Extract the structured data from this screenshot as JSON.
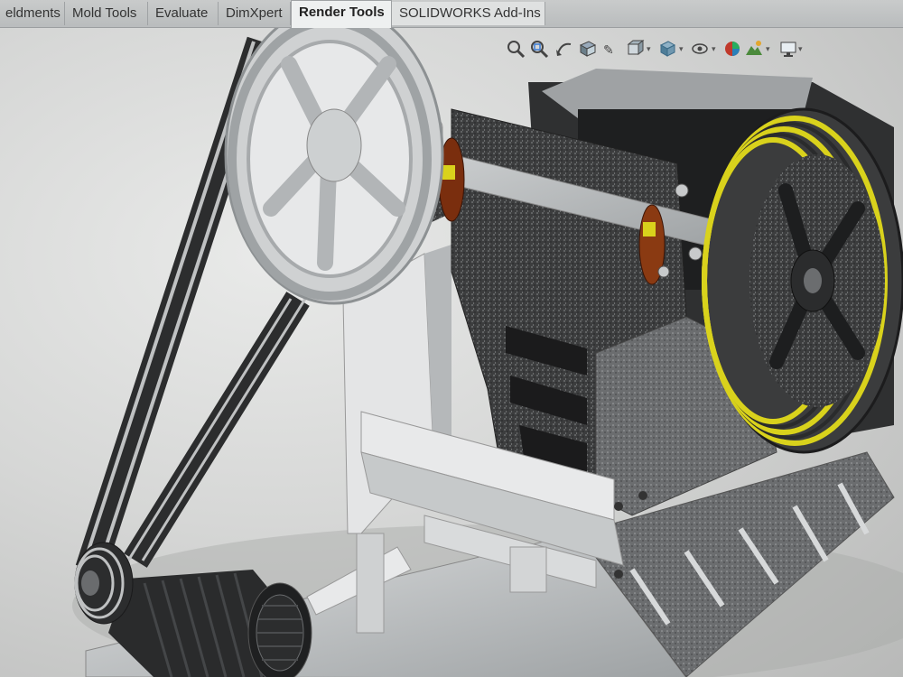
{
  "tabs": [
    {
      "label": "Weldments",
      "visible_label": "eldments"
    },
    {
      "label": "Mold Tools"
    },
    {
      "label": "Evaluate"
    },
    {
      "label": "DimXpert"
    },
    {
      "label": "Render Tools"
    },
    {
      "label": "SOLIDWORKS Add-Ins"
    }
  ],
  "active_tab": "Render Tools",
  "heads_up_toolbar": {
    "icons": [
      "zoom-to-fit-icon",
      "zoom-to-area-icon",
      "previous-view-icon",
      "section-view-icon",
      "dynamic-annotation-icon",
      "view-orientation-icon",
      "display-style-icon",
      "hide-show-items-icon",
      "edit-appearance-icon",
      "apply-scene-icon",
      "view-settings-icon"
    ]
  },
  "colors": {
    "belt_groove_accent": "#d9d21c",
    "bearing_copper": "#8a3a12",
    "frame_steel": "#bfc2c3",
    "housing_dark": "#3a3b3c"
  }
}
